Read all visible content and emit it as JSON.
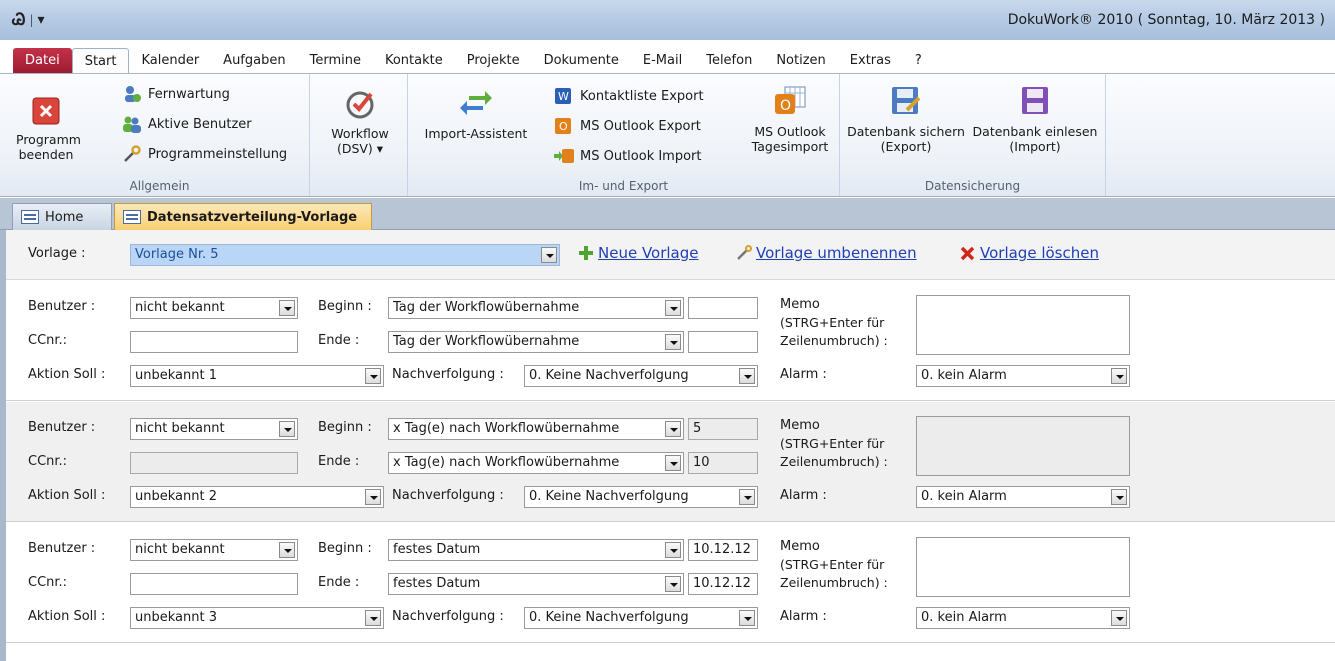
{
  "titlebar": {
    "logo": "Ꮚ",
    "sep": "|",
    "qat_menu": "▾",
    "title": "DokuWork® 2010 ( Sonntag, 10. März 2013 )"
  },
  "tabs": [
    {
      "label": "Datei"
    },
    {
      "label": "Start"
    },
    {
      "label": "Kalender"
    },
    {
      "label": "Aufgaben"
    },
    {
      "label": "Termine"
    },
    {
      "label": "Kontakte"
    },
    {
      "label": "Projekte"
    },
    {
      "label": "Dokumente"
    },
    {
      "label": "E-Mail"
    },
    {
      "label": "Telefon"
    },
    {
      "label": "Notizen"
    },
    {
      "label": "Extras"
    },
    {
      "label": "?"
    }
  ],
  "ribbon": {
    "allgemein": {
      "label": "Allgemein",
      "programm_beenden": "Programm beenden",
      "fernwartung": "Fernwartung",
      "aktive_benutzer": "Aktive Benutzer",
      "programmeinstellung": "Programmeinstellung"
    },
    "workflow": {
      "label": "Workflow",
      "sub": "(DSV) ▾"
    },
    "import_export": {
      "label": "Im- und Export",
      "import_assistent": "Import-Assistent",
      "kontaktliste_export": "Kontaktliste Export",
      "ms_outlook_export": "MS Outlook Export",
      "ms_outlook_import": "MS Outlook Import",
      "ms_outlook_tagesimport": "MS Outlook Tagesimport"
    },
    "datensicherung": {
      "label": "Datensicherung",
      "sichern": "Datenbank sichern (Export)",
      "einlesen": "Datenbank einlesen (Import)"
    }
  },
  "doctabs": {
    "home": "Home",
    "active": "Datensatzverteilung-Vorlage"
  },
  "vorlage": {
    "label": "Vorlage :",
    "value": "Vorlage Nr. 5",
    "neue": "Neue Vorlage",
    "umbenennen": "Vorlage umbenennen",
    "loeschen": "Vorlage löschen"
  },
  "labels": {
    "benutzer": "Benutzer :",
    "ccnr": "CCnr.:",
    "aktion": "Aktion Soll :",
    "beginn": "Beginn :",
    "ende": "Ende :",
    "nachverfolgung": "Nachverfolgung :",
    "memo": "Memo",
    "memo2": "(STRG+Enter für",
    "memo3": "Zeilenumbruch) :",
    "alarm": "Alarm :"
  },
  "rows": [
    {
      "benutzer": "nicht bekannt",
      "ccnr": "",
      "aktion": "unbekannt 1",
      "beginn": "Tag der Workflowübernahme",
      "beginn_val": "",
      "ende": "Tag der Workflowübernahme",
      "ende_val": "",
      "nachverfolgung": "0. Keine Nachverfolgung",
      "alarm": "0. kein Alarm"
    },
    {
      "benutzer": "nicht bekannt",
      "ccnr": "",
      "aktion": "unbekannt 2",
      "beginn": "x Tag(e) nach Workflowübernahme",
      "beginn_val": "5",
      "ende": "x Tag(e) nach Workflowübernahme",
      "ende_val": "10",
      "nachverfolgung": "0. Keine Nachverfolgung",
      "alarm": "0. kein Alarm"
    },
    {
      "benutzer": "nicht bekannt",
      "ccnr": "",
      "aktion": "unbekannt 3",
      "beginn": "festes Datum",
      "beginn_val": "10.12.12",
      "ende": "festes Datum",
      "ende_val": "10.12.12",
      "nachverfolgung": "0. Keine Nachverfolgung",
      "alarm": "0. kein Alarm"
    }
  ]
}
